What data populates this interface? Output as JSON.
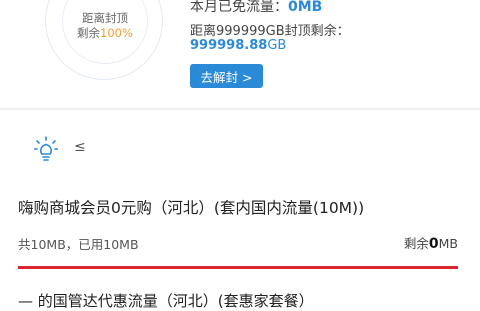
{
  "summary": {
    "ring_line1": "距离封顶",
    "ring_line2_prefix": "剩余",
    "ring_percent": "100%",
    "used_label": "本月已免流量：",
    "used_value": "0MB",
    "remain_label": "距离999999GB封顶剩余：",
    "remain_number": "999998.88",
    "remain_unit": "GB",
    "unlock_button": "去解封 >"
  },
  "tip": {
    "icon": "lightbulb-icon",
    "text": "≤"
  },
  "package": {
    "title": "嗨购商城会员0元购（河北）(套内国内流量(10M))",
    "total_used": "共10MB，已用10MB",
    "remain_label": "剩余",
    "remain_value": "0",
    "remain_unit": "MB"
  },
  "next_package": {
    "title": "— 的国管达代惠流量（河北）(套惠家套餐）"
  },
  "colors": {
    "accent_blue": "#2b8ad8",
    "percent_orange": "#f0a030",
    "divider_red": "#d9252b"
  }
}
